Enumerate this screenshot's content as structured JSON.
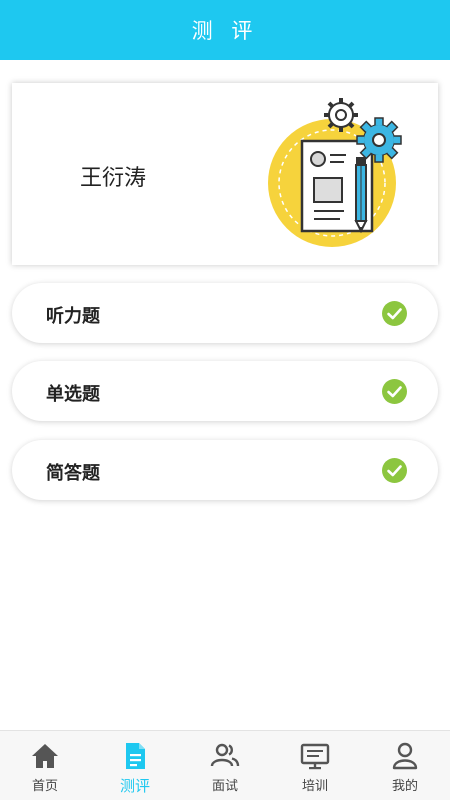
{
  "header": {
    "title": "测 评"
  },
  "profile": {
    "name": "王衍涛",
    "illustration": "document-gear-pencil-illustration"
  },
  "exams": [
    {
      "label": "听力题",
      "status_icon": "check-circle-icon",
      "completed": true
    },
    {
      "label": "单选题",
      "status_icon": "check-circle-icon",
      "completed": true
    },
    {
      "label": "简答题",
      "status_icon": "check-circle-icon",
      "completed": true
    }
  ],
  "tabbar": {
    "items": [
      {
        "label": "首页",
        "icon": "home-icon"
      },
      {
        "label": "测评",
        "icon": "document-icon",
        "active": true
      },
      {
        "label": "面试",
        "icon": "people-icon"
      },
      {
        "label": "培训",
        "icon": "board-icon"
      },
      {
        "label": "我的",
        "icon": "user-icon"
      }
    ]
  },
  "colors": {
    "accent": "#1ec8f0",
    "check": "#8cc63f",
    "illustration_yellow": "#f6d33c",
    "illustration_blue": "#3cb6e3"
  }
}
